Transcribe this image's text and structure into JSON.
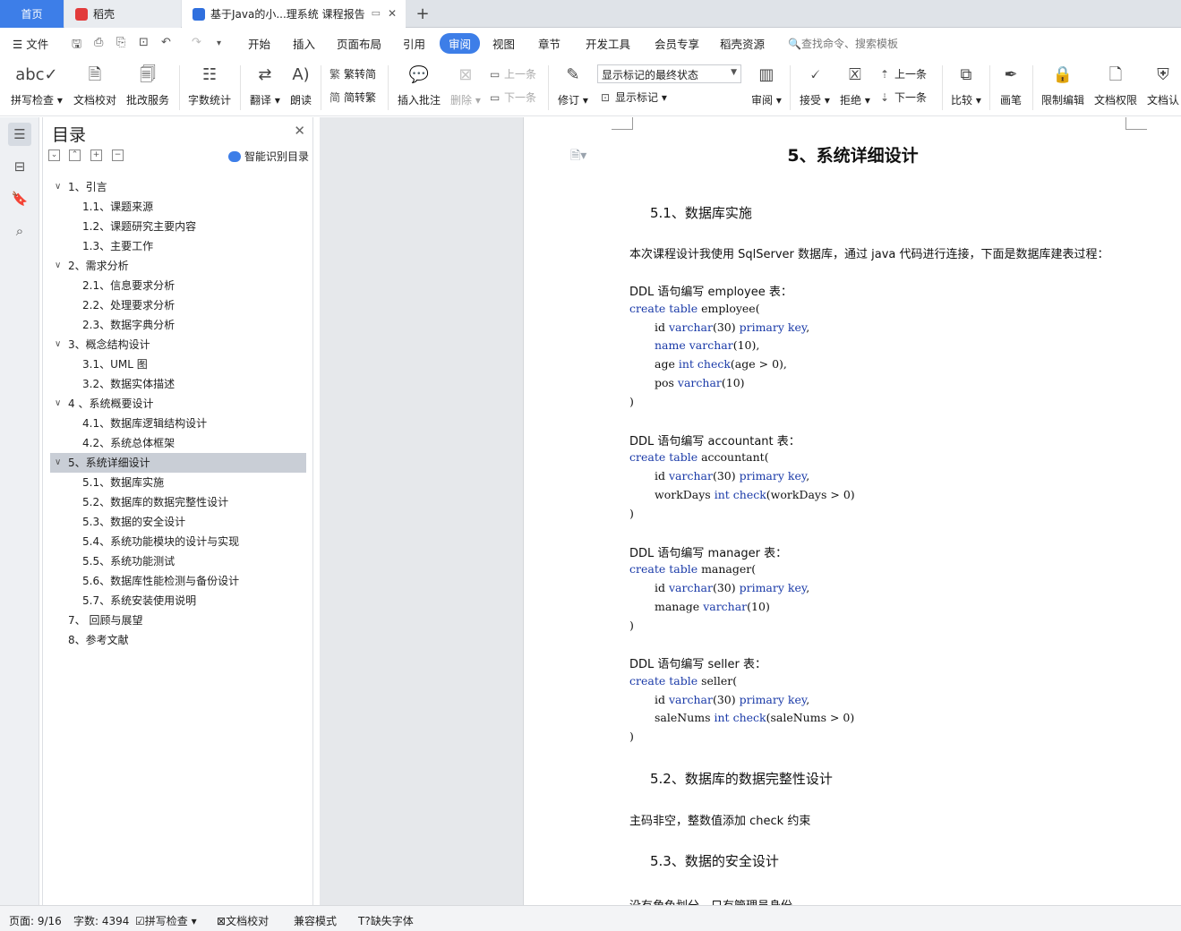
{
  "tabs": {
    "home": "首页",
    "daoke": "稻壳",
    "doc": "基于Java的小...理系统 课程报告",
    "new_tab": "+"
  },
  "menu": {
    "file": "文件",
    "items": [
      "开始",
      "插入",
      "页面布局",
      "引用",
      "审阅",
      "视图",
      "章节",
      "开发工具",
      "会员专享",
      "稻壳资源"
    ],
    "active": "审阅",
    "search": "查找命令、搜索模板"
  },
  "ribbon": {
    "spell_check": "拼写检查",
    "doc_proof": "文档校对",
    "batch_correct": "批改服务",
    "word_count": "字数统计",
    "translate": "翻译",
    "read_aloud": "朗读",
    "trad_to_simp": "繁转简",
    "simp_to_trad": "简转繁",
    "insert_comment": "插入批注",
    "delete": "删除",
    "prev_comment": "上一条",
    "next_comment": "下一条",
    "revise": "修订",
    "markup_state": "显示标记的最终状态",
    "show_markup": "显示标记",
    "review": "审阅",
    "accept": "接受",
    "reject": "拒绝",
    "prev_change": "上一条",
    "next_change": "下一条",
    "compare": "比较",
    "ink": "画笔",
    "restrict_edit": "限制编辑",
    "doc_permission": "文档权限",
    "doc_cert": "文档认"
  },
  "toc": {
    "title": "目录",
    "smart": "智能识别目录",
    "items": [
      {
        "label": "1、引言",
        "level": 1,
        "toggle": "∨"
      },
      {
        "label": "1.1、课题来源",
        "level": 2
      },
      {
        "label": "1.2、课题研究主要内容",
        "level": 2
      },
      {
        "label": "1.3、主要工作",
        "level": 2
      },
      {
        "label": "2、需求分析",
        "level": 1,
        "toggle": "∨"
      },
      {
        "label": "2.1、信息要求分析",
        "level": 2
      },
      {
        "label": "2.2、处理要求分析",
        "level": 2
      },
      {
        "label": "2.3、数据字典分析",
        "level": 2
      },
      {
        "label": "3、概念结构设计",
        "level": 1,
        "toggle": "∨"
      },
      {
        "label": "3.1、UML 图",
        "level": 2
      },
      {
        "label": "3.2、数据实体描述",
        "level": 2
      },
      {
        "label": "4 、系统概要设计",
        "level": 1,
        "toggle": "∨"
      },
      {
        "label": "4.1、数据库逻辑结构设计",
        "level": 2
      },
      {
        "label": "4.2、系统总体框架",
        "level": 2
      },
      {
        "label": "5、系统详细设计",
        "level": 1,
        "toggle": "∨",
        "selected": true
      },
      {
        "label": "5.1、数据库实施",
        "level": 2
      },
      {
        "label": "5.2、数据库的数据完整性设计",
        "level": 2
      },
      {
        "label": "5.3、数据的安全设计",
        "level": 2
      },
      {
        "label": "5.4、系统功能模块的设计与实现",
        "level": 2
      },
      {
        "label": "5.5、系统功能测试",
        "level": 2
      },
      {
        "label": "5.6、数据库性能检测与备份设计",
        "level": 2
      },
      {
        "label": "5.7、系统安装使用说明",
        "level": 2
      },
      {
        "label": "7、  回顾与展望",
        "level": 1
      },
      {
        "label": "8、参考文献",
        "level": 1
      }
    ]
  },
  "doc": {
    "h1": "5、系统详细设计",
    "h2_1": "5.1、数据库实施",
    "intro": "本次课程设计我使用 SqlServer 数据库，通过 java 代码进行连接，下面是数据库建表过程：",
    "ddl_employee": "DDL 语句编写 employee 表：",
    "c_emp_1": "create table employee(",
    "c_emp_2": "id varchar(30) primary key,",
    "c_emp_3": "name varchar(10),",
    "c_emp_4": "age int check(age > 0),",
    "c_emp_5": "pos varchar(10)",
    "c_close": ")",
    "ddl_accountant": "DDL 语句编写 accountant 表：",
    "c_acc_1": "create table accountant(",
    "c_acc_2": "id varchar(30) primary key,",
    "c_acc_3": "workDays int check(workDays > 0)",
    "ddl_manager": "DDL 语句编写 manager 表：",
    "c_man_1": "create table manager(",
    "c_man_2": "id varchar(30) primary key,",
    "c_man_3": "manage varchar(10)",
    "ddl_seller": "DDL 语句编写 seller 表：",
    "c_sel_1": "create table seller(",
    "c_sel_2": "id varchar(30) primary key,",
    "c_sel_3": "saleNums int check(saleNums > 0)",
    "h2_2": "5.2、数据库的数据完整性设计",
    "p_integrity": "主码非空，整数值添加 check 约束",
    "h2_3": "5.3、数据的安全设计",
    "p_security": "没有角色划分，只有管理员身份"
  },
  "status": {
    "page": "页面: 9/16",
    "words": "字数: 4394",
    "spell": "拼写检查",
    "proof": "文档校对",
    "compat": "兼容模式",
    "missing_font": "缺失字体"
  }
}
